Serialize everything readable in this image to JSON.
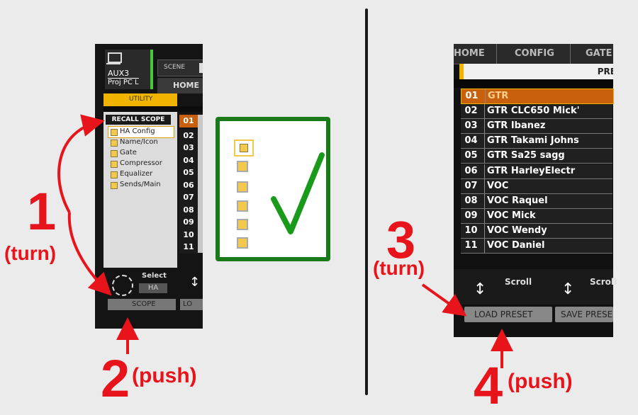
{
  "left": {
    "header": {
      "aux": "AUX3",
      "proj": "Proj PC L",
      "scene": "SCENE",
      "home": "HOME",
      "utility": "UTILITY"
    },
    "recall_scope": "RECALL SCOPE",
    "items": [
      "HA Config",
      "Name/Icon",
      "Gate",
      "Compressor",
      "Equalizer",
      "Sends/Main"
    ],
    "numbers": [
      "01",
      "02",
      "03",
      "04",
      "05",
      "06",
      "07",
      "08",
      "09",
      "10",
      "11"
    ],
    "select": {
      "label": "Select",
      "value": "HA"
    },
    "buttons": {
      "scope": "SCOPE",
      "lo": "LO"
    }
  },
  "right": {
    "header": {
      "home": "HOME",
      "config": "CONFIG",
      "gate": "GATE",
      "pre": "PRE"
    },
    "presets": [
      {
        "num": "01",
        "name": "GTR"
      },
      {
        "num": "02",
        "name": "GTR CLC650 Mick'"
      },
      {
        "num": "03",
        "name": "GTR Ibanez"
      },
      {
        "num": "04",
        "name": "GTR Takami Johns"
      },
      {
        "num": "05",
        "name": "GTR Sa25 sagg"
      },
      {
        "num": "06",
        "name": "GTR HarleyElectr"
      },
      {
        "num": "07",
        "name": "VOC"
      },
      {
        "num": "08",
        "name": "VOC Raquel"
      },
      {
        "num": "09",
        "name": "VOC Mick"
      },
      {
        "num": "10",
        "name": "VOC Wendy"
      },
      {
        "num": "11",
        "name": "VOC Daniel"
      }
    ],
    "scroll1": "Scroll",
    "scroll2": "Scroll",
    "load_preset": "LOAD PRESET",
    "save_preset": "SAVE PRESE"
  },
  "annotations": {
    "step1": "1",
    "step1_note": "(turn)",
    "step2": "2",
    "step2_note": "(push)",
    "step3": "3",
    "step3_note": "(turn)",
    "step4": "4",
    "step4_note": "(push)"
  },
  "colors": {
    "accent_red": "#e8141b",
    "check_green": "#1a7a1a",
    "highlight_orange": "#c8600e",
    "yellow": "#f2c94c"
  }
}
